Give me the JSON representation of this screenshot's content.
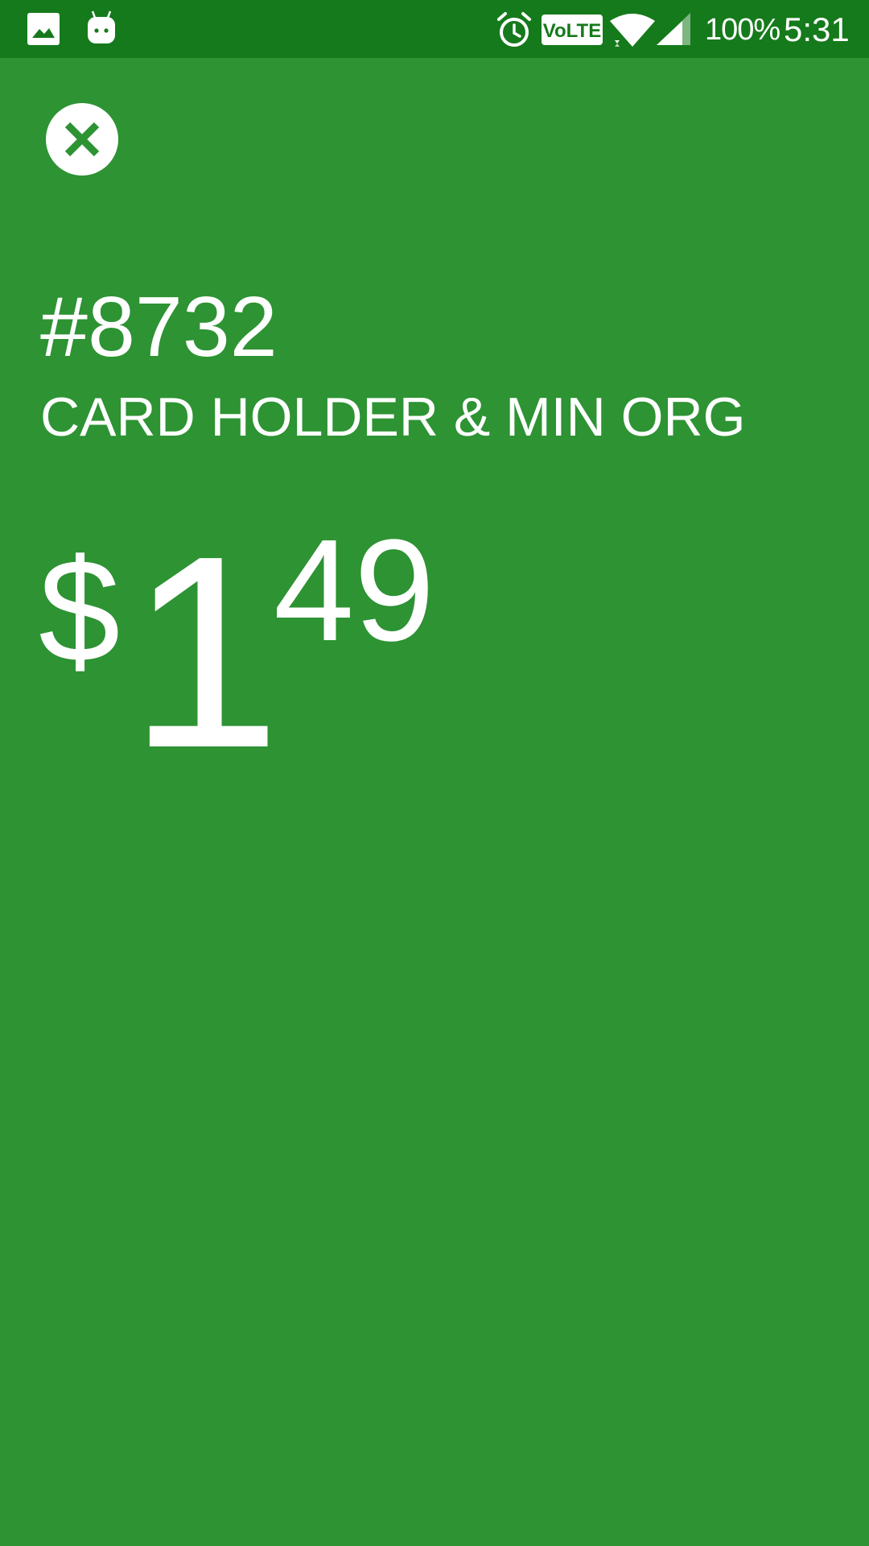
{
  "status_bar": {
    "notification_icons": [
      "gallery-icon",
      "android-icon"
    ],
    "system_icons": [
      "alarm-icon",
      "volte-icon",
      "wifi-icon",
      "signal-icon"
    ],
    "volte_label": "VoLTE",
    "battery": "100%",
    "time": "5:31"
  },
  "close_icon": "close-circle-icon",
  "transaction": {
    "order_number": "#8732",
    "merchant": "CARD HOLDER & MIN ORG",
    "amount": {
      "currency_symbol": "$",
      "dollars": "1",
      "cents": "49"
    }
  },
  "colors": {
    "background": "#2d9333",
    "status_bar": "#157a1b",
    "text": "#ffffff"
  }
}
